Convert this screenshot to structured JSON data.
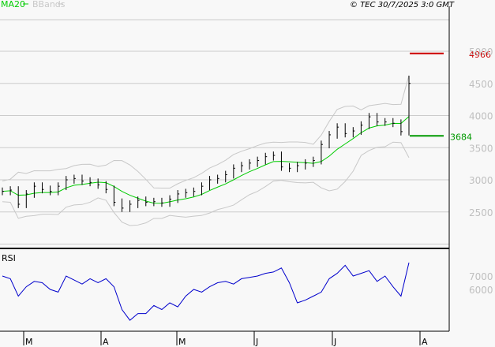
{
  "header": {
    "legend_ma": "MA20",
    "legend_bb": "BBands",
    "copyright": "© TEC 30/7/2025 3:0 GMT"
  },
  "colors": {
    "price": "#000000",
    "ma": "#00cc00",
    "bbands": "#c8c8c8",
    "rsi": "#0000cc",
    "target": "#cc0000",
    "support": "#009900",
    "grid": "#cccccc",
    "axis_text": "#c0c0c0"
  },
  "chart_data": [
    {
      "type": "line",
      "title": "Price (bars) with MA20 and Bollinger Bands",
      "ylim": [
        2000,
        5200
      ],
      "y_ticks": [
        2500,
        3000,
        3500,
        4000,
        4500,
        5000
      ],
      "y_tick_labels": [
        "2500",
        "3000",
        "3500",
        "4000",
        "4500",
        "5000"
      ],
      "x_tick_labels": [
        "M",
        "A",
        "M",
        "J",
        "J",
        "A"
      ],
      "close": [
        2820,
        2840,
        2620,
        2780,
        2900,
        2850,
        2820,
        2900,
        3000,
        3020,
        2980,
        2960,
        2920,
        2850,
        2650,
        2560,
        2620,
        2680,
        2650,
        2660,
        2640,
        2700,
        2780,
        2800,
        2820,
        2900,
        3000,
        3020,
        3080,
        3180,
        3220,
        3260,
        3300,
        3360,
        3380,
        3200,
        3180,
        3220,
        3260,
        3300,
        3550,
        3700,
        3820,
        3720,
        3760,
        3850,
        3980,
        3900,
        3900,
        3880,
        3750,
        4500
      ],
      "last_high": 4620,
      "annotations": [
        {
          "label": "4966",
          "value": 4966,
          "color": "#cc0000"
        },
        {
          "label": "3684",
          "value": 3684,
          "color": "#009900"
        }
      ]
    },
    {
      "type": "line",
      "title": "RSI",
      "ylim": [
        30,
        90
      ],
      "y_ticks": [
        60,
        70
      ],
      "y_tick_labels": [
        "6000",
        "7000"
      ],
      "values": [
        70,
        68,
        55,
        62,
        66,
        65,
        60,
        58,
        70,
        67,
        64,
        68,
        65,
        68,
        62,
        45,
        37,
        42,
        42,
        48,
        45,
        50,
        47,
        55,
        60,
        58,
        62,
        65,
        66,
        64,
        68,
        69,
        70,
        72,
        73,
        76,
        65,
        50,
        52,
        55,
        58,
        68,
        72,
        78,
        70,
        72,
        74,
        66,
        70,
        62,
        55,
        80
      ]
    }
  ]
}
